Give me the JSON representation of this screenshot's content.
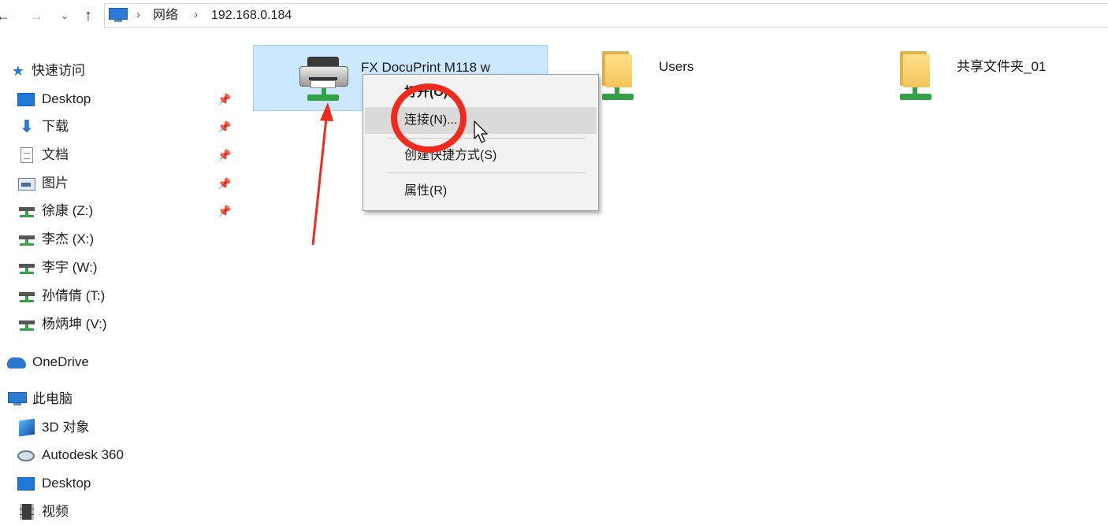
{
  "address_bar": {
    "back_icon": "arrow-left-icon",
    "forward_icon": "arrow-right-icon",
    "recent_icon": "chevron-down-icon",
    "up_icon": "arrow-up-icon",
    "location_icon": "this-pc-icon",
    "path": [
      "网络",
      "192.168.0.184"
    ],
    "separator": "›"
  },
  "sidebar": {
    "quick_access": {
      "label": "快速访问",
      "items": [
        {
          "label": "Desktop",
          "icon": "desktop-icon",
          "pinned": true
        },
        {
          "label": "下载",
          "icon": "download-icon",
          "pinned": true
        },
        {
          "label": "文档",
          "icon": "documents-icon",
          "pinned": true
        },
        {
          "label": "图片",
          "icon": "pictures-icon",
          "pinned": true
        },
        {
          "label": "徐康 (Z:)",
          "icon": "network-drive-icon",
          "pinned": true
        },
        {
          "label": "李杰 (X:)",
          "icon": "network-drive-icon",
          "pinned": false
        },
        {
          "label": "李宇 (W:)",
          "icon": "network-drive-icon",
          "pinned": false
        },
        {
          "label": "孙倩倩  (T:)",
          "icon": "network-drive-icon",
          "pinned": false
        },
        {
          "label": "杨炳坤 (V:)",
          "icon": "network-drive-icon",
          "pinned": false
        }
      ]
    },
    "onedrive": {
      "label": "OneDrive",
      "icon": "cloud-icon"
    },
    "this_pc": {
      "label": "此电脑",
      "items": [
        {
          "label": "3D 对象",
          "icon": "3d-objects-icon"
        },
        {
          "label": "Autodesk 360",
          "icon": "autodesk-icon"
        },
        {
          "label": "Desktop",
          "icon": "desktop-icon"
        },
        {
          "label": "视频",
          "icon": "video-icon"
        }
      ]
    },
    "pin_glyph": "📌"
  },
  "content": {
    "items": [
      {
        "label": "FX DocuPrint M118 w",
        "icon": "network-printer-icon",
        "selected": true
      },
      {
        "label": "Users",
        "icon": "shared-folder-icon",
        "selected": false
      },
      {
        "label": "共享文件夹_01",
        "icon": "shared-folder-icon",
        "selected": false
      }
    ]
  },
  "context_menu": {
    "items": [
      {
        "label": "打开(O)",
        "default": true
      },
      {
        "label": "连接(N)...",
        "hover": true
      },
      {
        "label": "创建快捷方式(S)"
      },
      {
        "label": "属性(R)"
      }
    ]
  },
  "annotation": {
    "color": "#ee2b1f"
  }
}
